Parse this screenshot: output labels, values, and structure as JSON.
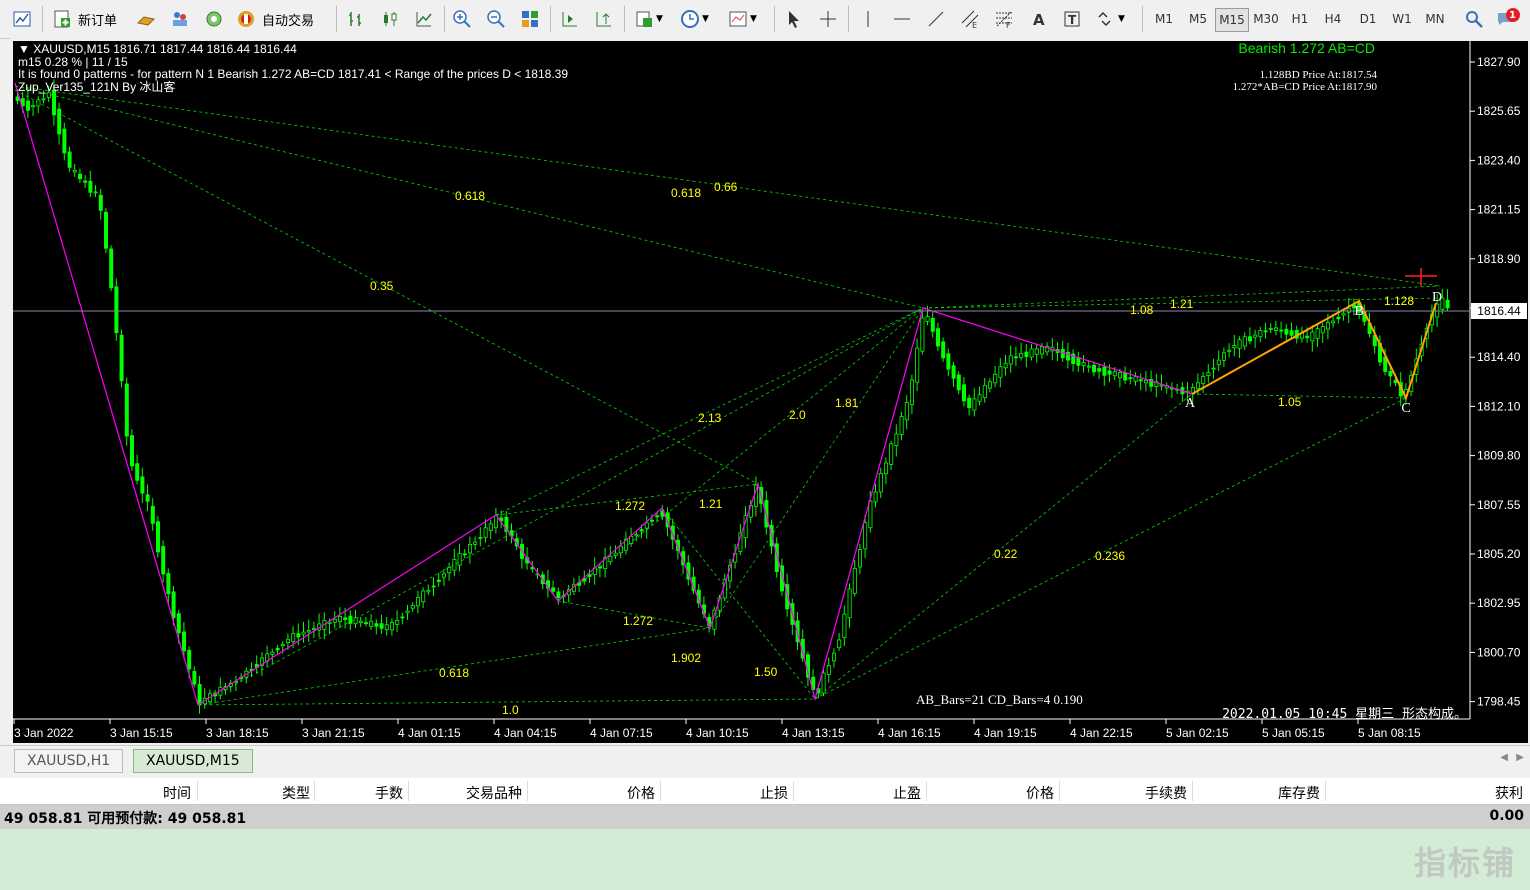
{
  "toolbar": {
    "new_order_label": "新订单",
    "auto_trade_label": "自动交易",
    "timeframes": [
      "M1",
      "M5",
      "M15",
      "M30",
      "H1",
      "H4",
      "D1",
      "W1",
      "MN"
    ],
    "active_timeframe": "M15",
    "notification_count": "1"
  },
  "chart": {
    "header_line1": "XAUUSD,M15  1816.71 1817.44 1816.44 1816.44",
    "header_line2": "m15  0.28 % | 11 / 15",
    "header_line3": "It is found 0 patterns  -  for pattern N 1 Bearish 1.272 AB=CD  1817.41 < Range of the prices D < 1818.39",
    "header_line4": "Zup_Ver135_121N By 冰山客",
    "pattern_title": "Bearish 1.272 AB=CD",
    "pattern_info1": "1.128BD Price At:1817.54",
    "pattern_info2": "1.272*AB=CD Price At:1817.90",
    "bars_info": "AB_Bars=21 CD_Bars=4 0.190",
    "status_text": "2022.01.05 10:45 星期三  形态构成。",
    "current_price": "1816.44",
    "price_axis": [
      "1827.90",
      "1825.65",
      "1823.40",
      "1821.15",
      "1818.90",
      "1816.65",
      "1814.40",
      "1812.10",
      "1809.80",
      "1807.55",
      "1805.20",
      "1802.95",
      "1800.70",
      "1798.45"
    ],
    "time_axis": [
      "3 Jan 2022",
      "3 Jan 15:15",
      "3 Jan 18:15",
      "3 Jan 21:15",
      "4 Jan 01:15",
      "4 Jan 04:15",
      "4 Jan 07:15",
      "4 Jan 10:15",
      "4 Jan 13:15",
      "4 Jan 16:15",
      "4 Jan 19:15",
      "4 Jan 22:15",
      "5 Jan 02:15",
      "5 Jan 05:15",
      "5 Jan 08:15"
    ],
    "point_labels": [
      "A",
      "B",
      "C",
      "D"
    ],
    "fib_labels": [
      "0.618",
      "0.618",
      "0.66",
      "0.35",
      "1.21",
      "1.08",
      "1.128",
      "2.13",
      "2.0",
      "1.81",
      "1.272",
      "1.21",
      "1.272",
      "1.902",
      "1.50",
      "0.618",
      "1.0",
      "0.22",
      "0.236",
      "1.05"
    ],
    "colors": {
      "background": "#000000",
      "bull": "#00ff00",
      "bear": "#00ff00",
      "zigzag": "#ff00ff",
      "pattern": "#ffa500",
      "fib": "#00ff00",
      "fib_text": "#ffff00",
      "price_line": "#8888aa"
    }
  },
  "tabs": [
    {
      "label": "XAUUSD,H1",
      "active": false
    },
    {
      "label": "XAUUSD,M15",
      "active": true
    }
  ],
  "terminal": {
    "columns": [
      "时间",
      "类型",
      "手数",
      "交易品种",
      "价格",
      "止损",
      "止盈",
      "价格",
      "手续费",
      "库存费",
      "获利"
    ],
    "balance_text": "49 058.81  可用预付款: 49 058.81",
    "profit_total": "0.00"
  },
  "watermark": "指标铺"
}
